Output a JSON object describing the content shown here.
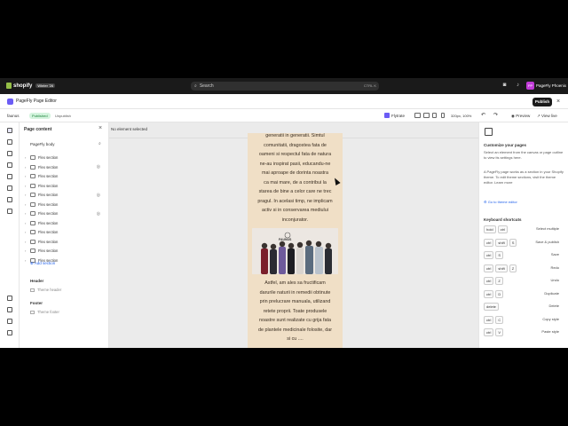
{
  "shopify": {
    "brand": "shopify",
    "badge": "Winter '26",
    "search_placeholder": "Search",
    "search_kbd": "CTRL K",
    "account": "PageFly Phoenix",
    "account_initials": "PP"
  },
  "editor": {
    "title": "PageFly Page Editor",
    "publish": "Publish",
    "store": "faunus",
    "status": "Published",
    "unpublish": "Unpublish",
    "flytrate": "Flytrate",
    "size": "320px, 100%",
    "preview": "Preview",
    "view_live": "View live"
  },
  "left_panel": {
    "title": "Page content",
    "body_label": "PageFly body",
    "sections": [
      "Flex section",
      "Flex section",
      "Flex section",
      "Flex section",
      "Flex section",
      "Flex section",
      "Flex section",
      "Flex section",
      "Flex section",
      "Flex section",
      "Flex section",
      "Flex section"
    ],
    "add_section": "Add section",
    "header": "Header",
    "header_item": "Theme header",
    "footer": "Footer",
    "footer_item": "Theme footer"
  },
  "canvas": {
    "status": "No element selected",
    "text_top": "generatii in generatii. Simtul\ncomunitatii, dragostea fata de\noameni si respectul fata de natura\nne-au inspirat pasii, educandu-ne\nmai aproape de dorinta noastra\nca mai mare, de a contribui la\nstarea de bine a celor care ne trec\npragul. In acelasi timp, ne implicam\nactiv si in conservarea mediului\ninconjurator.",
    "photo_caption": "FAUNUS",
    "text_bottom": "Astfel, am ales sa fructificam\ndarurile naturii in remedii obtinute\nprin prelucrare manuala, utilizand\nretete proprii. Toate produsele\nnoastre sunt realizate cu grija fata\nde plantele medicinale folosite, dar\nsi cu ...."
  },
  "right_panel": {
    "heading": "Customize your pages",
    "p1": "Select an element from the canvas or page outline to view its settings here.",
    "p2": "A PageFly page works as a section in your Shopify theme. To edit theme sections, visit the theme editor. Learn more",
    "link": "Go to theme editor",
    "shortcuts_title": "Keyboard shortcuts",
    "shortcuts": [
      {
        "keys": [
          "hold",
          "ctrl"
        ],
        "action": "Select multiple"
      },
      {
        "keys": [
          "ctrl",
          "shift",
          "S"
        ],
        "action": "Save & publish"
      },
      {
        "keys": [
          "ctrl",
          "S"
        ],
        "action": "Save"
      },
      {
        "keys": [
          "ctrl",
          "shift",
          "Z"
        ],
        "action": "Redo"
      },
      {
        "keys": [
          "ctrl",
          "Z"
        ],
        "action": "Undo"
      },
      {
        "keys": [
          "ctrl",
          "D"
        ],
        "action": "Duplicate"
      },
      {
        "keys": [
          "delete"
        ],
        "action": "Delete"
      },
      {
        "keys": [
          "ctrl",
          "C"
        ],
        "action": "Copy style"
      },
      {
        "keys": [
          "ctrl",
          "V"
        ],
        "action": "Paste style"
      }
    ]
  }
}
